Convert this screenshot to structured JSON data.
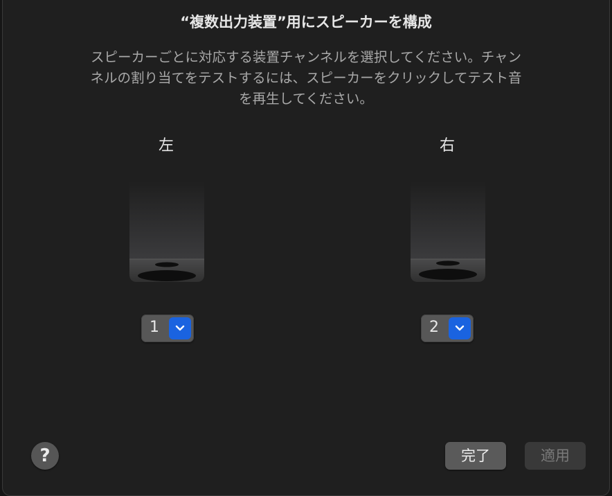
{
  "dialog": {
    "title": "“複数出力装置”用にスピーカーを構成",
    "description_lines": [
      "スピーカーごとに対応する装置チャンネルを選択してください。チャン",
      "ネルの割り当てをテストするには、スピーカーをクリックしてテスト音",
      "を再生してください。"
    ]
  },
  "speakers": [
    {
      "label": "左",
      "channel": "1"
    },
    {
      "label": "右",
      "channel": "2"
    }
  ],
  "footer": {
    "help": "?",
    "done_label": "完了",
    "apply_label": "適用"
  },
  "colors": {
    "accent": "#1a63e0",
    "background": "#1f1f1f"
  }
}
